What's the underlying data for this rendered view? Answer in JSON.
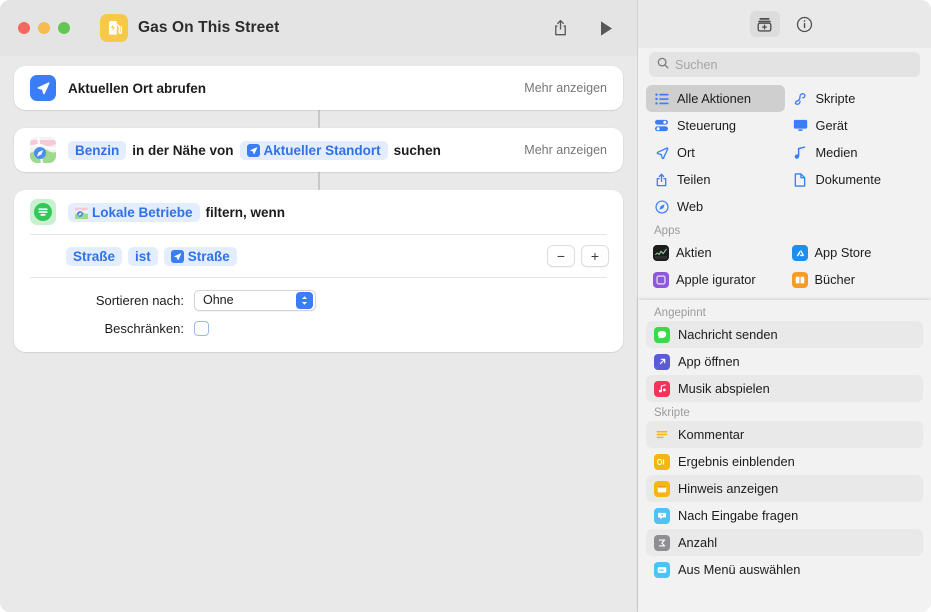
{
  "window": {
    "title": "Gas On This Street",
    "app_icon": "gas-pump-icon",
    "traffic_lights": [
      "close",
      "minimize",
      "zoom"
    ],
    "share_label": "share-icon",
    "run_label": "play-icon"
  },
  "colors": {
    "accent_blue": "#3b7df6",
    "token_blue": "#2f72e8",
    "token_bg": "#e4edfd",
    "app_icon_yellow": "#f7c94b",
    "filter_green": "#34c759",
    "canvas_bg": "#e9e9e9",
    "card_bg": "#ffffff",
    "sidebar_bg": "#f2f2f2"
  },
  "actions": [
    {
      "icon": "location-arrow-icon",
      "label": "Aktuellen Ort abrufen",
      "more": "Mehr anzeigen"
    },
    {
      "icon": "maps-icon",
      "token1": "Benzin",
      "mid": "in der Nähe von",
      "token2": "Aktueller Standort",
      "suffix": "suchen",
      "more": "Mehr anzeigen"
    },
    {
      "icon": "filter-icon",
      "token": "Lokale Betriebe",
      "label": "filtern, wenn",
      "condition": {
        "field": "Straße",
        "operator": "ist",
        "value": "Straße",
        "remove": "−",
        "add": "+"
      },
      "sort_label": "Sortieren nach:",
      "sort_value": "Ohne",
      "limit_label": "Beschränken:",
      "limit_checked": false
    }
  ],
  "library": {
    "toolbar": {
      "action_library": "action-library-icon",
      "info": "info-icon"
    },
    "search": {
      "placeholder": "Suchen",
      "icon": "search-icon"
    },
    "categories": [
      {
        "label": "Alle Aktionen",
        "icon": "list-icon",
        "selected": true
      },
      {
        "label": "Skripte",
        "icon": "scripts-icon",
        "selected": false
      },
      {
        "label": "Steuerung",
        "icon": "controls-icon",
        "selected": false
      },
      {
        "label": "Gerät",
        "icon": "device-icon",
        "selected": false
      },
      {
        "label": "Ort",
        "icon": "location-icon",
        "selected": false
      },
      {
        "label": "Medien",
        "icon": "media-icon",
        "selected": false
      },
      {
        "label": "Teilen",
        "icon": "share-icon",
        "selected": false
      },
      {
        "label": "Dokumente",
        "icon": "documents-icon",
        "selected": false
      },
      {
        "label": "Web",
        "icon": "web-icon",
        "selected": false
      }
    ],
    "apps_header": "Apps",
    "apps": [
      {
        "label": "Aktien",
        "icon": "stocks-icon",
        "color": "#1c1c1e"
      },
      {
        "label": "App Store",
        "icon": "appstore-icon",
        "color": "#1e8ef0"
      },
      {
        "label": "Apple  igurator",
        "icon": "configurator-icon",
        "color": "#8e59d8"
      },
      {
        "label": "Bücher",
        "icon": "books-icon",
        "color": "#f59b28"
      }
    ],
    "pinned_header": "Angepinnt",
    "pinned": [
      {
        "label": "Nachricht senden",
        "icon": "messages-icon",
        "color": "#3bd84a"
      },
      {
        "label": "App öffnen",
        "icon": "open-app-icon",
        "color": "#5b5bd6"
      },
      {
        "label": "Musik abspielen",
        "icon": "music-icon",
        "color": "#f7325a"
      }
    ],
    "scripts_header": "Skripte",
    "scripts": [
      {
        "label": "Kommentar",
        "icon": "comment-icon",
        "color": "#ffffff"
      },
      {
        "label": "Ergebnis einblenden",
        "icon": "show-result-icon",
        "color": "#f5b513"
      },
      {
        "label": "Hinweis anzeigen",
        "icon": "show-alert-icon",
        "color": "#f5b513"
      },
      {
        "label": "Nach Eingabe fragen",
        "icon": "ask-input-icon",
        "color": "#4cc2f5"
      },
      {
        "label": "Anzahl",
        "icon": "count-icon",
        "color": "#8e8e93"
      },
      {
        "label": "Aus Menü auswählen",
        "icon": "choose-menu-icon",
        "color": "#4cc2f5"
      }
    ]
  }
}
